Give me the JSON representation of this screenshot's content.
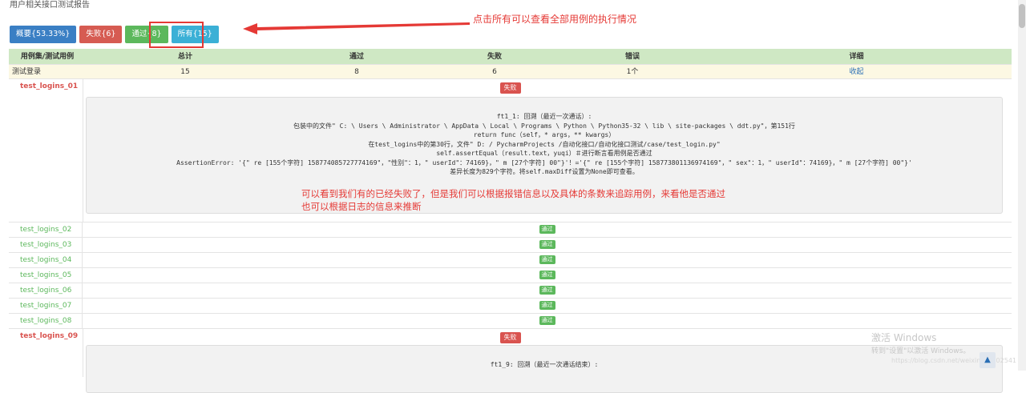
{
  "page": {
    "top_text": "用户相关接口测试报告"
  },
  "tabs": [
    {
      "label": "概要{53.33%}",
      "color": "#3a7fc4"
    },
    {
      "label": "失败{6}",
      "color": "#d65b52"
    },
    {
      "label": "通过{8}",
      "color": "#5cb85c"
    },
    {
      "label": "所有{15}",
      "color": "#3bb0d6"
    }
  ],
  "annotations": {
    "tab_hint": "点击所有可以查看全部用例的执行情况",
    "fail_hint_line1": "可以看到我们有的已经失败了，但是我们可以根据报错信息以及具体的条数来追踪用例，来看他是否通过",
    "fail_hint_line2": "也可以根据日志的信息来推断"
  },
  "table": {
    "headers": [
      "用例集/测试用例",
      "总计",
      "通过",
      "失败",
      "错误",
      "详细"
    ],
    "summary": {
      "name": "测试登录",
      "total": "15",
      "pass": "8",
      "fail": "6",
      "error": "1个",
      "detail": "收起"
    }
  },
  "cases": {
    "c01": {
      "name": "test_logins_01",
      "status": "失败",
      "log": [
        "ft1_1: 回溯（最近一次通话）:",
        "包装中的文件\" C: \\ Users \\ Administrator \\ AppData \\ Local \\ Programs \\ Python \\ Python35-32 \\ lib \\ site-packages \\ ddt.py\"，第151行",
        "return func（self，* args，** kwargs）",
        "在test_logins中的第30行，文件\" D: / PycharmProjects /自动化接口/自动化接口测试/case/test_login.py\"",
        "self.assertEqual（result.text，yuqi）＃进行断言看用例是否通过",
        "AssertionError: '{\" re [155个字符] 158774085727774169\"，\"性别\"：1，\" userId\"：74169}，\" m [27个字符] 00\"}'！='{\" re [155个字符] 158773801136974169\"，\" sex\"：1，\" userId\"：74169}，\" m [27个字符] 00\"}'",
        "差异长度为829个字符。将self.maxDiff设置为None即可查看。"
      ]
    },
    "passed": [
      {
        "name": "test_logins_02",
        "status": "通过"
      },
      {
        "name": "test_logins_03",
        "status": "通过"
      },
      {
        "name": "test_logins_04",
        "status": "通过"
      },
      {
        "name": "test_logins_05",
        "status": "通过"
      },
      {
        "name": "test_logins_06",
        "status": "通过"
      },
      {
        "name": "test_logins_07",
        "status": "通过"
      },
      {
        "name": "test_logins_08",
        "status": "通过"
      }
    ],
    "c09": {
      "name": "test_logins_09",
      "status": "失败",
      "log_first": "ft1_9: 回溯（最近一次通话结束）:"
    }
  },
  "watermark": {
    "title": "激活 Windows",
    "sub": "转到\"设置\"以激活 Windows。",
    "csdn": "https://blog.csdn.net/weixin_43802541"
  }
}
